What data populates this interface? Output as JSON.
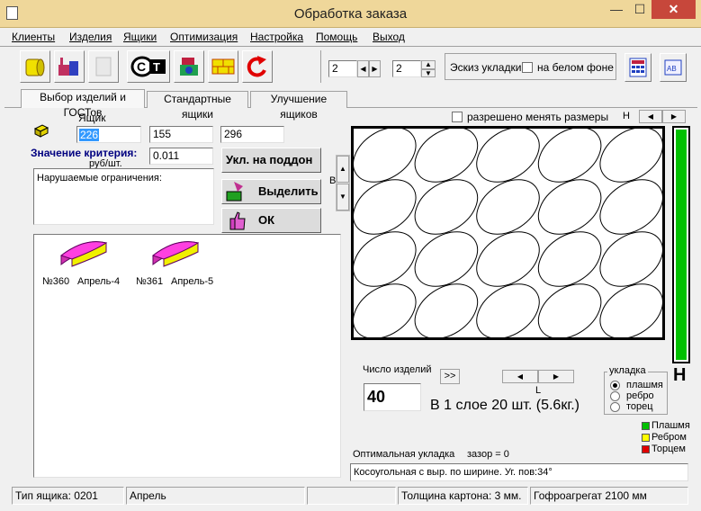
{
  "window": {
    "title": "Обработка заказа",
    "min": "—",
    "max": "☐",
    "close": "✕"
  },
  "menu": [
    "Клиенты",
    "Изделия",
    "Ящики",
    "Оптимизация",
    "Настройка",
    "Помощь",
    "Выход"
  ],
  "toolbar": {
    "spin1": "2",
    "spin2": "2",
    "sketch_label": "Эскиз укладки",
    "white_bg_label": "на белом фоне"
  },
  "tabs": [
    "Выбор изделий и ГОСТов",
    "Стандартные ящики",
    "Улучшение ящиков"
  ],
  "box": {
    "label": "Ящик",
    "dim1": "226",
    "dim2": "155",
    "dim3": "296",
    "criterion_label": "Значение критерия:",
    "criterion_unit": "руб/шт.",
    "criterion_value": "0.011",
    "violations_label": "Нарушаемые ограничения:"
  },
  "buttons": {
    "pallet": "Укл. на поддон",
    "select": "Выделить",
    "ok": "ОК",
    "b_label": "B",
    "arrows": ">>"
  },
  "products": [
    {
      "num": "№360",
      "name": "Апрель-4"
    },
    {
      "num": "№361",
      "name": "Апрель-5"
    }
  ],
  "layout_view": {
    "resize_label": "разрешено  менять размеры",
    "h_label": "H",
    "h_big": "H",
    "l_label": "L",
    "count_label": "Число изделий",
    "count_value": "40",
    "per_layer": "В 1 слое 20 шт. (5.6кг.)",
    "stack_label": "укладка",
    "stack_options": [
      "плашмя",
      "ребро",
      "торец"
    ],
    "legend": [
      {
        "label": "Плашмя",
        "color": "#00c000"
      },
      {
        "label": "Ребром",
        "color": "#ffff00"
      },
      {
        "label": "Торцем",
        "color": "#e00000"
      }
    ],
    "optimal_label": "Оптимальная укладка",
    "gap_label": "зазор = 0",
    "description": "Косоугольная с выр. по ширине. Уг. пов:34°"
  },
  "statusbar": [
    "Тип ящика: 0201",
    "Апрель",
    "",
    "Толщина картона: 3 мм.",
    "Гофроагрегат 2100 мм"
  ]
}
